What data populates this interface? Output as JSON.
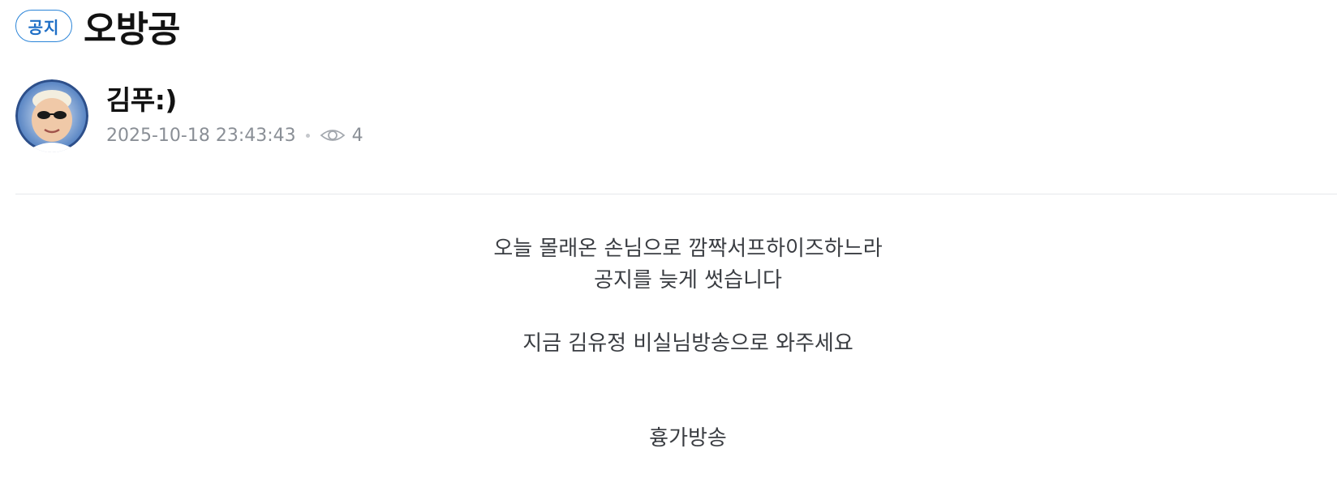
{
  "post": {
    "badge": "공지",
    "title": "오방공"
  },
  "author": {
    "name": "김푸:)",
    "avatar": "avatar-photo"
  },
  "meta": {
    "datetime": "2025-10-18 23:43:43",
    "view_icon": "eye-icon",
    "views": "4"
  },
  "content": {
    "line1": "오늘 몰래온 손님으로 깜짝서프하이즈하느라",
    "line2": "공지를 늦게 썻습니다",
    "line3": "지금 김유정 비실님방송으로 와주세요",
    "line4": "흉가방송"
  },
  "colors": {
    "badge_border": "#2a84d8",
    "badge_text": "#1f6fc6",
    "meta_text": "#8a8f96",
    "divider": "#e6e8eb"
  }
}
